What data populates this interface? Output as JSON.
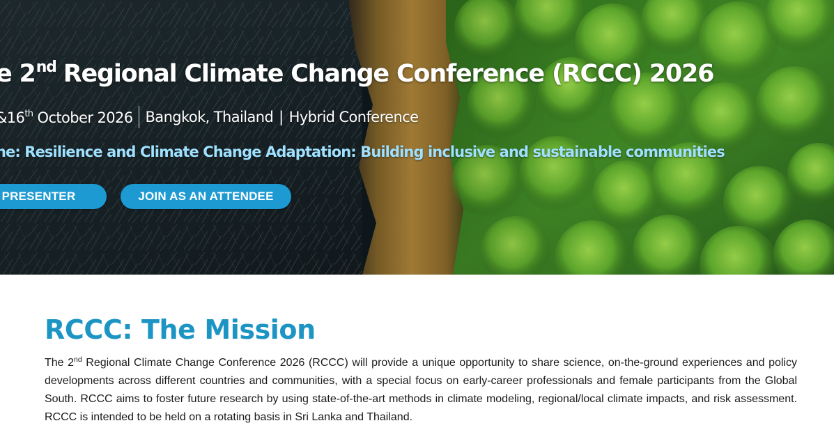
{
  "hero": {
    "title_pre": "e 2",
    "title_sup": "nd",
    "title_post": "Regional Climate Change Conference (RCCC) 2026",
    "dates_pre": "&16",
    "dates_sup": "th",
    "dates_post": " October 2026",
    "location": "Bangkok, Thailand",
    "pipe": "|",
    "format": "Hybrid Conference",
    "theme": "ne: Resilience and Climate Change Adaptation: Building inclusive and sustainable communities",
    "buttons": {
      "presenter": "E A PRESENTER",
      "attendee": "JOIN AS AN ATTENDEE"
    },
    "colors": {
      "theme_text": "#9fe1ff",
      "button": "#1d9ad2"
    }
  },
  "mission": {
    "title": "RCCC: The Mission",
    "body_pre": "The 2",
    "body_sup": "nd",
    "body_post": " Regional Climate Change Conference 2026 (RCCC) will provide a unique opportunity to share science, on-the-ground experiences and policy developments across different countries and communities, with a special focus on early-career professionals and female participants from the Global South. RCCC aims to foster future research by using state-of-the-art methods in climate modeling, regional/local climate impacts, and risk assessment. RCCC is intended to be held on a rotating basis in Sri Lanka and Thailand.",
    "colors": {
      "title": "#1c94c4"
    }
  }
}
